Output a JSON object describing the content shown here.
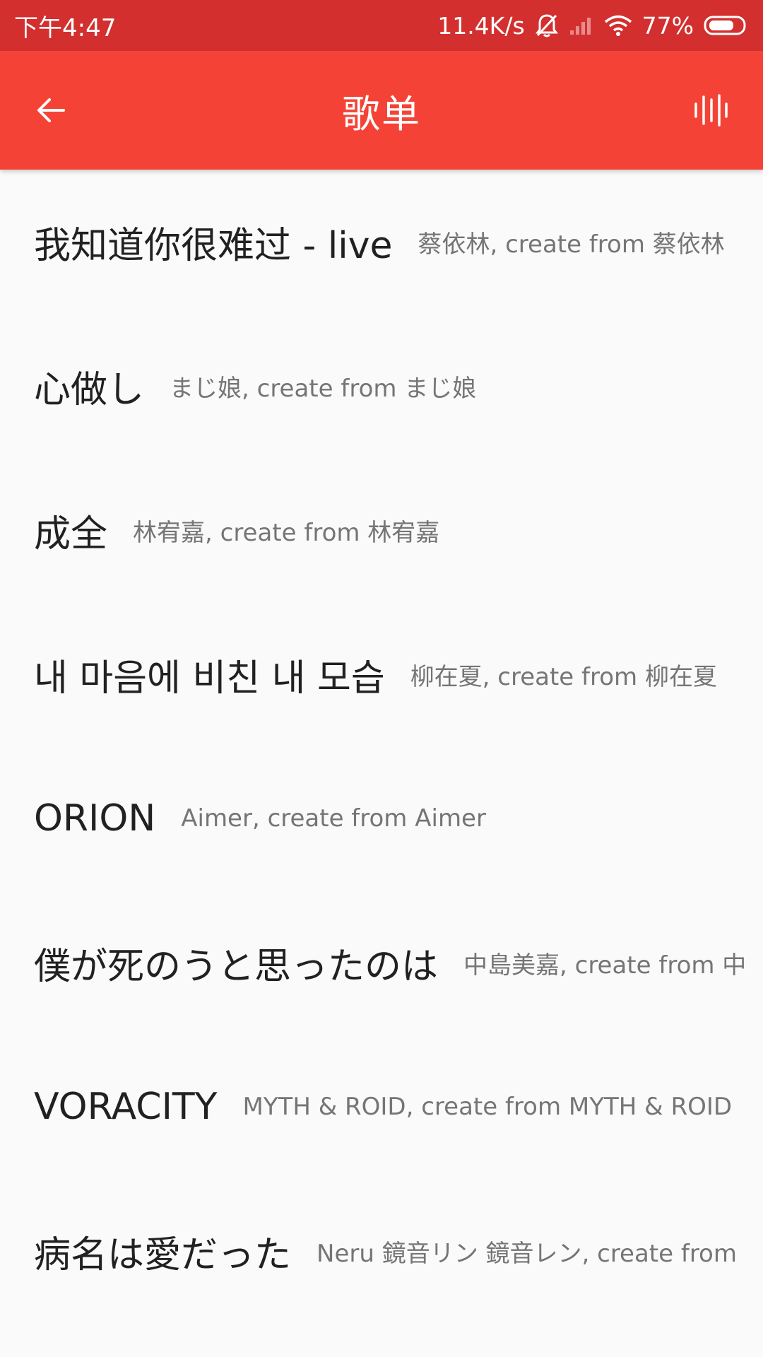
{
  "status_bar": {
    "time": "下午4:47",
    "net_speed": "11.4K/s",
    "battery": "77%",
    "icons": [
      "bell-off-icon",
      "signal-icon",
      "wifi-icon",
      "battery-icon"
    ]
  },
  "app_bar": {
    "title": "歌单",
    "back_icon": "back-arrow-icon",
    "action_icon": "now-playing-icon",
    "color": "#f44336",
    "status_color": "#d32f2f"
  },
  "playlist": [
    {
      "title": "我知道你很难过 - live",
      "subtitle": "蔡依林, create from 蔡依林"
    },
    {
      "title": "心做し",
      "subtitle": "まじ娘, create from まじ娘"
    },
    {
      "title": "成全",
      "subtitle": "林宥嘉, create from 林宥嘉"
    },
    {
      "title": "내 마음에 비친 내 모습",
      "subtitle": "柳在夏, create from 柳在夏"
    },
    {
      "title": "ORION",
      "subtitle": "Aimer, create from Aimer"
    },
    {
      "title": "僕が死のうと思ったのは",
      "subtitle": "中島美嘉, create from 中"
    },
    {
      "title": "VORACITY",
      "subtitle": "MYTH & ROID, create from MYTH & ROID"
    },
    {
      "title": "病名は愛だった",
      "subtitle": "Neru 鏡音リン 鏡音レン, create from"
    }
  ]
}
